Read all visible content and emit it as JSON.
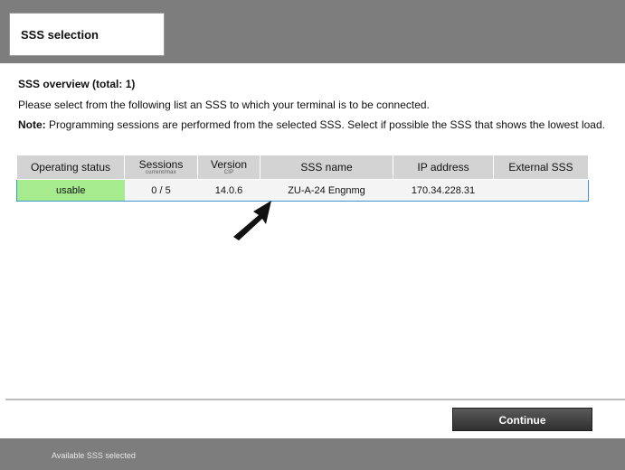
{
  "header": {
    "tab_title": "SSS selection"
  },
  "overview": {
    "title": "SSS overview (total: 1)",
    "instruction": "Please select from the following list an SSS to which your terminal is to be connected.",
    "note_label": "Note:",
    "note_text": " Programming sessions are performed from the selected SSS. Select if possible the SSS that shows the lowest load."
  },
  "table": {
    "columns": {
      "status": "Operating status",
      "sessions": "Sessions",
      "sessions_sub": "current/max",
      "version": "Version",
      "version_sub": "CIP",
      "name": "SSS name",
      "ip": "IP address",
      "external": "External SSS"
    },
    "rows": [
      {
        "status": "usable",
        "sessions": "0 / 5",
        "version": "14.0.6",
        "name": "ZU-A-24 Engnmg",
        "ip": "170.34.228.31",
        "external": ""
      }
    ]
  },
  "footer": {
    "continue_label": "Continue",
    "status_message": "Available SSS selected"
  },
  "colors": {
    "header_bg": "#7d7d7d",
    "usable_green": "#a6ec8e",
    "selection_border": "#3f95d0",
    "button_dark": "#3a3a3a"
  },
  "icons": {
    "pointer": "arrow-pointer-icon"
  }
}
